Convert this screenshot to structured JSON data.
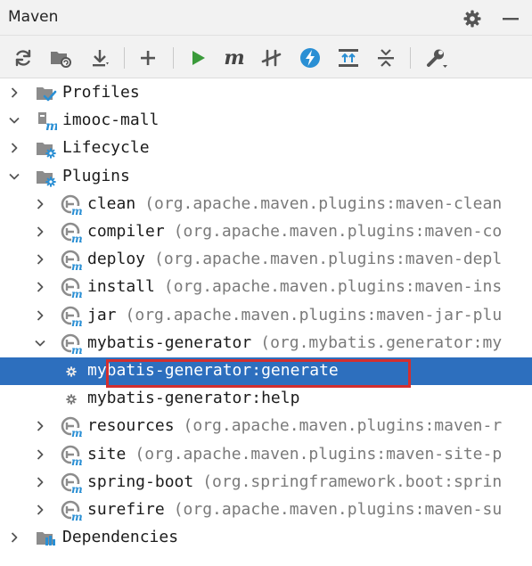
{
  "panel": {
    "title": "Maven"
  },
  "toolbar": {
    "buttons": [
      {
        "name": "reload-icon"
      },
      {
        "name": "generate-sources-icon"
      },
      {
        "name": "download-icon"
      },
      {
        "name": "add-icon"
      },
      {
        "name": "run-icon"
      },
      {
        "name": "execute-goal-icon",
        "glyph": "m"
      },
      {
        "name": "toggle-offline-icon"
      },
      {
        "name": "skip-tests-icon"
      },
      {
        "name": "show-dependencies-icon"
      },
      {
        "name": "collapse-all-icon"
      },
      {
        "name": "settings-wrench-icon"
      }
    ]
  },
  "tree": {
    "rows": [
      {
        "label": "Profiles",
        "sub": "",
        "icon": "profiles-icon",
        "expanded": false,
        "level": 0
      },
      {
        "label": "imooc-mall",
        "sub": "",
        "icon": "maven-module-icon",
        "expanded": true,
        "level": 0
      },
      {
        "label": "Lifecycle",
        "sub": "",
        "icon": "lifecycle-folder-icon",
        "expanded": false,
        "level": 1
      },
      {
        "label": "Plugins",
        "sub": "",
        "icon": "plugins-folder-icon",
        "expanded": true,
        "level": 1
      },
      {
        "label": "clean",
        "sub": "(org.apache.maven.plugins:maven-clean",
        "icon": "plugin-icon",
        "expanded": false,
        "level": 2
      },
      {
        "label": "compiler",
        "sub": "(org.apache.maven.plugins:maven-co",
        "icon": "plugin-icon",
        "expanded": false,
        "level": 2
      },
      {
        "label": "deploy",
        "sub": "(org.apache.maven.plugins:maven-depl",
        "icon": "plugin-icon",
        "expanded": false,
        "level": 2
      },
      {
        "label": "install",
        "sub": "(org.apache.maven.plugins:maven-ins",
        "icon": "plugin-icon",
        "expanded": false,
        "level": 2
      },
      {
        "label": "jar",
        "sub": "(org.apache.maven.plugins:maven-jar-plu",
        "icon": "plugin-icon",
        "expanded": false,
        "level": 2
      },
      {
        "label": "mybatis-generator",
        "sub": "(org.mybatis.generator:my",
        "icon": "plugin-icon",
        "expanded": true,
        "level": 2
      },
      {
        "label": "mybatis-generator:generate",
        "sub": "",
        "icon": "goal-gear-icon",
        "level": 3,
        "selected": true
      },
      {
        "label": "mybatis-generator:help",
        "sub": "",
        "icon": "goal-gear-icon",
        "level": 3
      },
      {
        "label": "resources",
        "sub": "(org.apache.maven.plugins:maven-r",
        "icon": "plugin-icon",
        "expanded": false,
        "level": 2
      },
      {
        "label": "site",
        "sub": "(org.apache.maven.plugins:maven-site-p",
        "icon": "plugin-icon",
        "expanded": false,
        "level": 2
      },
      {
        "label": "spring-boot",
        "sub": "(org.springframework.boot:sprin",
        "icon": "plugin-icon",
        "expanded": false,
        "level": 2
      },
      {
        "label": "surefire",
        "sub": "(org.apache.maven.plugins:maven-su",
        "icon": "plugin-icon",
        "expanded": false,
        "level": 2
      },
      {
        "label": "Dependencies",
        "sub": "",
        "icon": "dependencies-icon",
        "expanded": false,
        "level": 1
      }
    ]
  },
  "colors": {
    "selection": "#2d6fbe",
    "highlight_border": "#d32f2f",
    "run_green": "#3a9a3a",
    "accent_blue": "#2a8fd4",
    "icon_grey": "#555555"
  }
}
